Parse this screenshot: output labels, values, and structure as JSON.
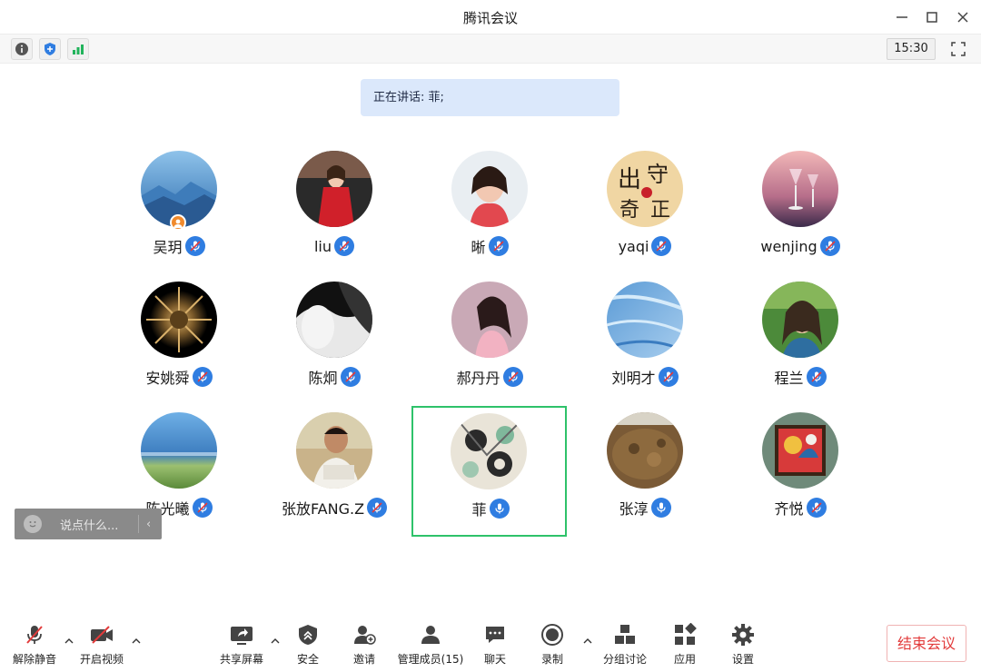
{
  "window": {
    "title": "腾讯会议"
  },
  "statusbar": {
    "clock": "15:30"
  },
  "speaking": {
    "text": "正在讲话: 菲;"
  },
  "participants": [
    {
      "name": "吴玥",
      "mic": "muted",
      "host": true
    },
    {
      "name": "liu",
      "mic": "muted"
    },
    {
      "name": "晰",
      "mic": "muted"
    },
    {
      "name": "yaqi",
      "mic": "muted"
    },
    {
      "name": "wenjing",
      "mic": "muted"
    },
    {
      "name": "安姚舜",
      "mic": "muted"
    },
    {
      "name": "陈炯",
      "mic": "muted"
    },
    {
      "name": "郝丹丹",
      "mic": "muted"
    },
    {
      "name": "刘明才",
      "mic": "muted"
    },
    {
      "name": "程兰",
      "mic": "muted"
    },
    {
      "name": "陈光曦",
      "mic": "muted"
    },
    {
      "name": "张放FANG.Z",
      "mic": "muted"
    },
    {
      "name": "菲",
      "mic": "on",
      "active": true
    },
    {
      "name": "张淳",
      "mic": "on"
    },
    {
      "name": "齐悦",
      "mic": "muted"
    }
  ],
  "chat": {
    "placeholder": "说点什么..."
  },
  "toolbar": {
    "unmute": "解除静音",
    "video": "开启视频",
    "share": "共享屏幕",
    "security": "安全",
    "invite": "邀请",
    "members": "管理成员(15)",
    "chat": "聊天",
    "record": "录制",
    "breakout": "分组讨论",
    "apps": "应用",
    "settings": "设置",
    "end": "结束会议"
  },
  "colors": {
    "accent": "#2f7de1",
    "active_border": "#2ec26a",
    "end_red": "#e23b3b",
    "banner_bg": "#dbe8fb"
  }
}
